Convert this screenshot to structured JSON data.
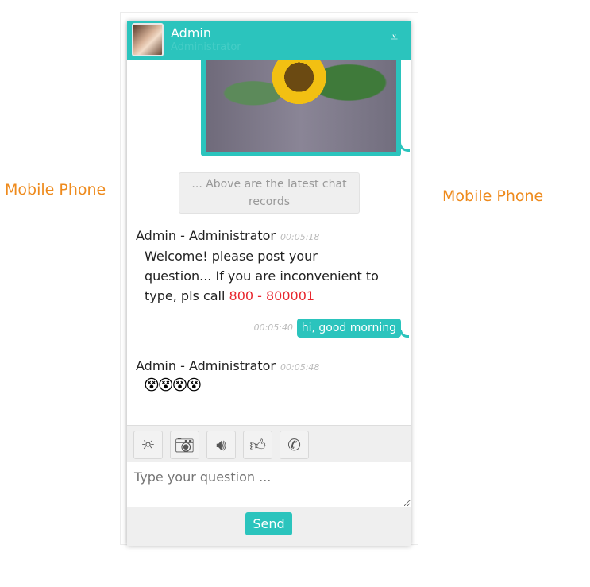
{
  "labels": {
    "left": "Mobile Phone",
    "right": "Mobile Phone"
  },
  "header": {
    "name": "Admin",
    "role": "Administrator",
    "minimize_icon": "chevron-down-bar-icon"
  },
  "notice": "... Above are the latest chat records",
  "messages": [
    {
      "sender": "Admin - Administrator",
      "time": "00:05:18",
      "text": "Welcome! please post your question... If you are inconvenient to type, pls call ",
      "phone": "800 - 800001"
    },
    {
      "sender": "me",
      "time": "00:05:40",
      "text": "hi, good morning"
    },
    {
      "sender": "Admin - Administrator",
      "time": "00:05:48",
      "emojis": "😵😵😵😵"
    }
  ],
  "toolbar": [
    "emoji-icon",
    "camera-icon",
    "audio-icon",
    "thumbs-up-icon",
    "phone-icon"
  ],
  "input": {
    "placeholder": "Type your question ..."
  },
  "send_label": "Send",
  "colors": {
    "accent": "#2bc4bd",
    "label": "#ee8a1c",
    "phone": "#e8262e"
  }
}
